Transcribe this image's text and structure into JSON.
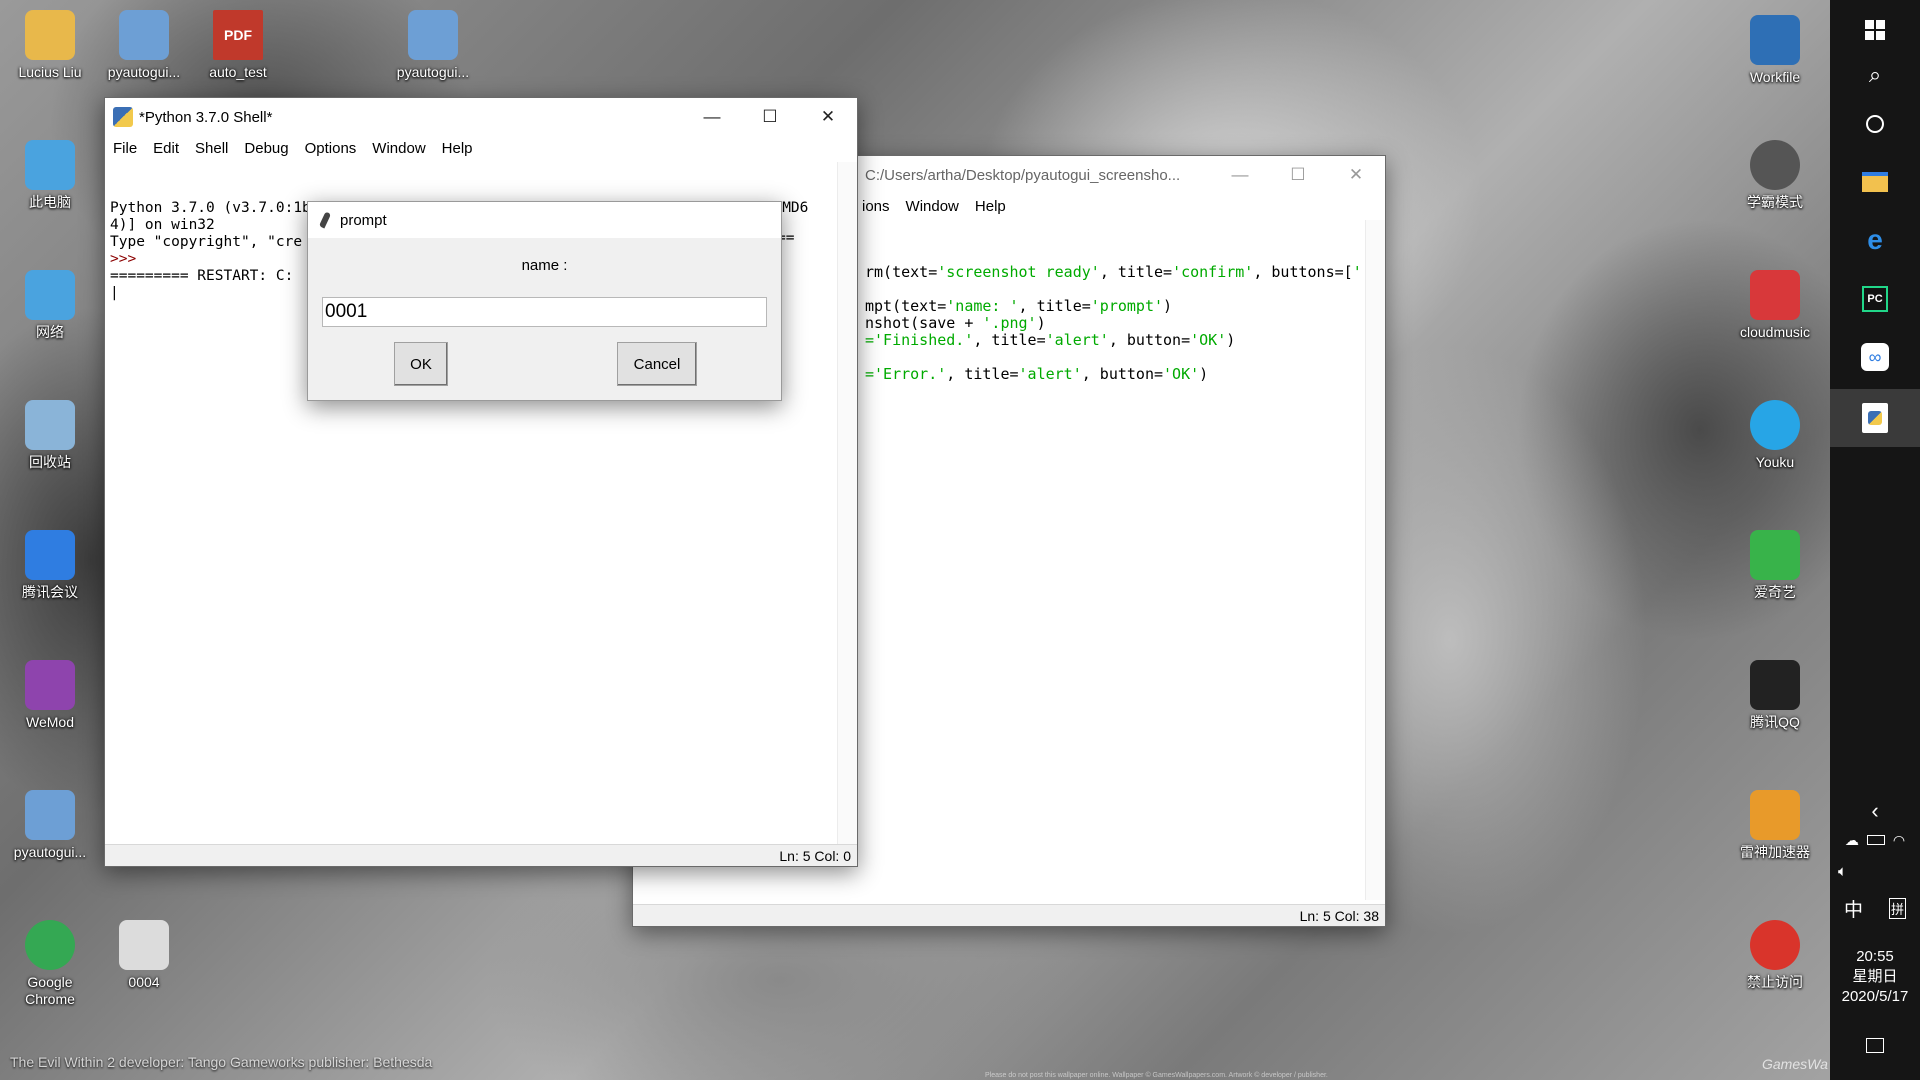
{
  "desktop_left_icons": [
    {
      "label": "Lucius Liu",
      "icon": "user-folder-icon",
      "color": "#e8b84b"
    },
    {
      "label": "pyautogui...",
      "icon": "python-file-icon",
      "color": "#6d9fd5"
    },
    {
      "label": "auto_test",
      "icon": "pdf-icon",
      "color": "#c0392b"
    },
    {
      "label": "pyautogui...",
      "icon": "python-file-icon",
      "color": "#6d9fd5"
    },
    {
      "label": "此电脑",
      "icon": "computer-icon",
      "color": "#4aa3df"
    },
    {
      "label": "网络",
      "icon": "network-icon",
      "color": "#4aa3df"
    },
    {
      "label": "回收站",
      "icon": "recycle-bin-icon",
      "color": "#8ab4d8"
    },
    {
      "label": "腾讯会议",
      "icon": "tencent-meeting-icon",
      "color": "#2f7de1"
    },
    {
      "label": "WeMod",
      "icon": "wemod-icon",
      "color": "#8e44ad"
    },
    {
      "label": "pyautogui...",
      "icon": "python-file-icon",
      "color": "#6d9fd5"
    },
    {
      "label": "Google Chrome",
      "icon": "chrome-icon",
      "color": "#34a853"
    },
    {
      "label": "0004",
      "icon": "image-file-icon",
      "color": "#dcdcdc"
    }
  ],
  "desktop_right_icons": [
    {
      "label": "Workfile",
      "icon": "folder-icon",
      "color": "#2e6fb5"
    },
    {
      "label": "学霸模式",
      "icon": "clock-icon",
      "color": "#555"
    },
    {
      "label": "cloudmusic",
      "icon": "cloudmusic-icon",
      "color": "#d8383a"
    },
    {
      "label": "Youku",
      "icon": "youku-icon",
      "color": "#27a5e6"
    },
    {
      "label": "爱奇艺",
      "icon": "iqiyi-icon",
      "color": "#38b34a"
    },
    {
      "label": "腾讯QQ",
      "icon": "qq-icon",
      "color": "#222"
    },
    {
      "label": "雷神加速器",
      "icon": "leishen-icon",
      "color": "#e89a2a"
    },
    {
      "label": "禁止访问",
      "icon": "forbidden-icon",
      "color": "#d9342b"
    }
  ],
  "shell": {
    "title": "*Python 3.7.0 Shell*",
    "menus": [
      "File",
      "Edit",
      "Shell",
      "Debug",
      "Options",
      "Window",
      "Help"
    ],
    "lines": [
      "Python 3.7.0 (v3.7.0:1bf9cc5093, Jun 27 2018, 04:59:51) [MSC v.1914 64 bit (AMD6",
      "4)] on win32",
      "Type \"copyright\", \"cre",
      ">>>",
      "========= RESTART: C:",
      "|"
    ],
    "restart_tail": "==",
    "status": "Ln: 5  Col: 0"
  },
  "editor": {
    "title": "C:/Users/artha/Desktop/pyautogui_screensho...",
    "menus": [
      "ions",
      "Window",
      "Help"
    ],
    "lines": [
      [
        {
          "t": "rm(text=",
          "c": "#000"
        },
        {
          "t": "'screenshot ready'",
          "c": "#00aa00"
        },
        {
          "t": ", title=",
          "c": "#000"
        },
        {
          "t": "'confirm'",
          "c": "#00aa00"
        },
        {
          "t": ", buttons=[",
          "c": "#000"
        },
        {
          "t": "'D",
          "c": "#00aa00"
        }
      ],
      [],
      [
        {
          "t": "mpt(text=",
          "c": "#000"
        },
        {
          "t": "'name: '",
          "c": "#00aa00"
        },
        {
          "t": ", title=",
          "c": "#000"
        },
        {
          "t": "'prompt'",
          "c": "#00aa00"
        },
        {
          "t": ")",
          "c": "#000"
        }
      ],
      [
        {
          "t": "nshot(save + ",
          "c": "#000"
        },
        {
          "t": "'.png'",
          "c": "#00aa00"
        },
        {
          "t": ")",
          "c": "#000"
        }
      ],
      [
        {
          "t": "='Finished.'",
          "c": "#00aa00"
        },
        {
          "t": ", title=",
          "c": "#000"
        },
        {
          "t": "'alert'",
          "c": "#00aa00"
        },
        {
          "t": ", button=",
          "c": "#000"
        },
        {
          "t": "'OK'",
          "c": "#00aa00"
        },
        {
          "t": ")",
          "c": "#000"
        }
      ],
      [],
      [
        {
          "t": "='Error.'",
          "c": "#00aa00"
        },
        {
          "t": ", title=",
          "c": "#000"
        },
        {
          "t": "'alert'",
          "c": "#00aa00"
        },
        {
          "t": ", button=",
          "c": "#000"
        },
        {
          "t": "'OK'",
          "c": "#00aa00"
        },
        {
          "t": ")",
          "c": "#000"
        }
      ]
    ],
    "status": "Ln: 5  Col: 38"
  },
  "prompt": {
    "title": "prompt",
    "label": "name :",
    "value": "0001",
    "ok": "OK",
    "cancel": "Cancel"
  },
  "taskbar": {
    "ime": "中",
    "ime2": "拼",
    "time": "20:55",
    "weekday": "星期日",
    "date": "2020/5/17"
  },
  "watermark": "The Evil Within 2  developer: Tango Gameworks  publisher: Bethesda",
  "footer_note": "Please do not post this wallpaper online. Wallpaper © GamesWallpapers.com. Artwork © developer / publisher.",
  "corner_logo": "GamesWa"
}
